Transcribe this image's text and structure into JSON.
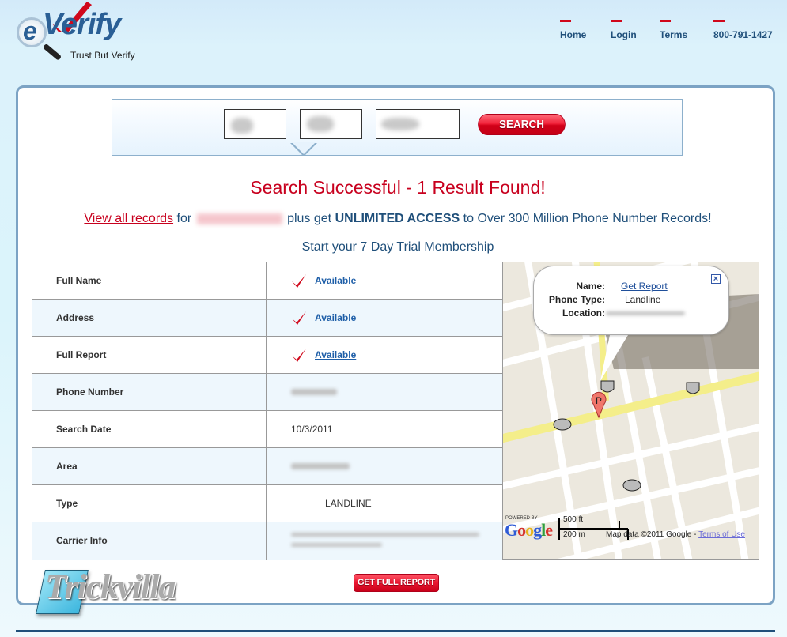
{
  "header": {
    "logo_text": "Verify",
    "logo_e": "e",
    "tagline": "Trust But Verify",
    "nav": [
      {
        "label": "Home"
      },
      {
        "label": "Login"
      },
      {
        "label": "Terms"
      },
      {
        "label": "800-791-1427"
      }
    ]
  },
  "search": {
    "button_label": "SEARCH",
    "fields": [
      {
        "name": "area-code",
        "value": ""
      },
      {
        "name": "prefix",
        "value": ""
      },
      {
        "name": "line-number",
        "value": ""
      }
    ]
  },
  "result": {
    "headline": "Search Successful - 1 Result Found!",
    "view_all_link": "View all records",
    "for_text": "for",
    "plus_text": "plus get",
    "unlimited_text": "UNLIMITED ACCESS",
    "rest_text": "to Over 300 Million Phone Number Records!",
    "trial_text": "Start your 7 Day Trial Membership"
  },
  "table": {
    "rows": [
      {
        "label": "Full Name",
        "value": "Available",
        "type": "available"
      },
      {
        "label": "Address",
        "value": "Available",
        "type": "available"
      },
      {
        "label": "Full Report",
        "value": "Available",
        "type": "available"
      },
      {
        "label": "Phone Number",
        "value": "",
        "type": "redacted"
      },
      {
        "label": "Search Date",
        "value": "10/3/2011",
        "type": "text"
      },
      {
        "label": "Area",
        "value": "",
        "type": "redacted"
      },
      {
        "label": "Type",
        "value": "LANDLINE",
        "type": "text"
      },
      {
        "label": "Carrier Info",
        "value": "",
        "type": "redacted"
      }
    ]
  },
  "map": {
    "bubble": {
      "name_label": "Name:",
      "name_value": "Get Report",
      "phone_type_label": "Phone Type:",
      "phone_type_value": "Landline",
      "location_label": "Location:"
    },
    "marker_letter": "P",
    "powered_by": "POWERED BY",
    "google": "Google",
    "scale_ft": "500 ft",
    "scale_m": "200 m",
    "map_data": "Map data ©2011 Google -",
    "terms_link": "Terms of Use"
  },
  "actions": {
    "full_report_label": "GET FULL REPORT"
  },
  "watermark": {
    "text": "Trickvilla"
  },
  "colors": {
    "brand_blue": "#1f4f7a",
    "accent_red": "#c8001e",
    "link_blue": "#1f5fa8"
  }
}
